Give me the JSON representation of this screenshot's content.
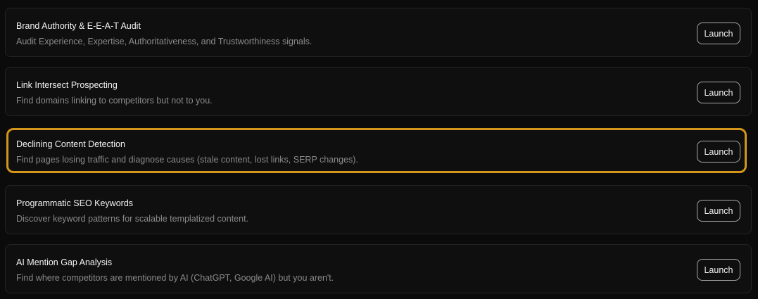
{
  "tools": [
    {
      "title": "Brand Authority & E-E-A-T Audit",
      "description": "Audit Experience, Expertise, Authoritativeness, and Trustworthiness signals.",
      "button_label": "Launch"
    },
    {
      "title": "Link Intersect Prospecting",
      "description": "Find domains linking to competitors but not to you.",
      "button_label": "Launch"
    },
    {
      "title": "Declining Content Detection",
      "description": "Find pages losing traffic and diagnose causes (stale content, lost links, SERP changes).",
      "button_label": "Launch",
      "highlighted": true
    },
    {
      "title": "Programmatic SEO Keywords",
      "description": "Discover keyword patterns for scalable templatized content.",
      "button_label": "Launch"
    },
    {
      "title": "AI Mention Gap Analysis",
      "description": "Find where competitors are mentioned by AI (ChatGPT, Google AI) but you aren't.",
      "button_label": "Launch"
    }
  ],
  "colors": {
    "highlight_border": "#d4961a",
    "background": "#0b0b0b",
    "card_background": "#0f0f0f"
  }
}
